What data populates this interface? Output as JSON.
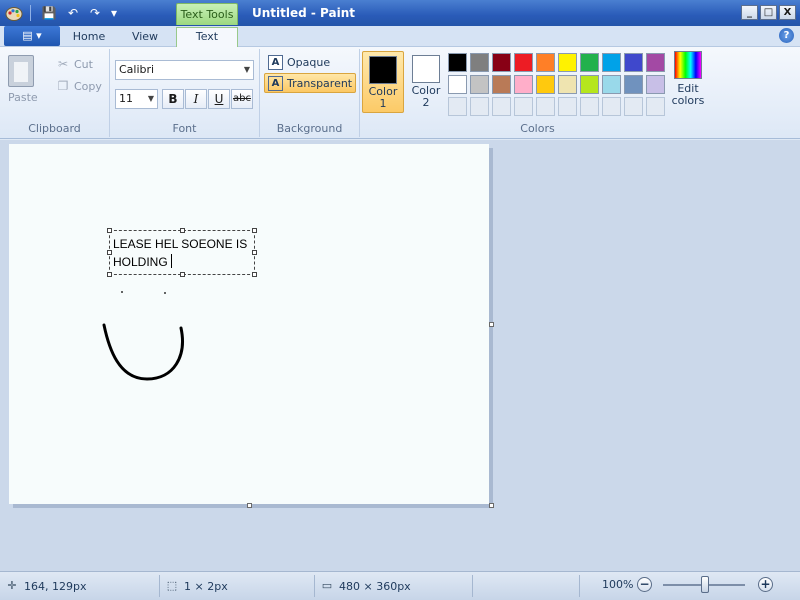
{
  "window": {
    "title": "Untitled - Paint",
    "context_tab_title": "Text Tools",
    "controls": {
      "minimize": "_",
      "maximize": "□",
      "close": "X"
    }
  },
  "quick_access": {
    "save": "💾",
    "undo": "↶",
    "redo": "↷",
    "customize": "▾"
  },
  "ribbon_tabs": {
    "app_menu": "▤ ▾",
    "home": "Home",
    "view": "View",
    "text": "Text",
    "active": "Text",
    "help": "?"
  },
  "clipboard": {
    "paste": "Paste",
    "cut": "Cut",
    "copy": "Copy",
    "label": "Clipboard"
  },
  "font": {
    "family": "Calibri",
    "size": "11",
    "bold": "B",
    "italic": "I",
    "underline": "U",
    "strikethrough": "abc",
    "label": "Font"
  },
  "background": {
    "opaque": "Opaque",
    "transparent": "Transparent",
    "selected": "Transparent",
    "label": "Background"
  },
  "colors": {
    "color1_label": "Color",
    "color1_num": "1",
    "color1_value": "#000000",
    "color2_label": "Color",
    "color2_num": "2",
    "color2_value": "#ffffff",
    "edit_colors_line1": "Edit",
    "edit_colors_line2": "colors",
    "label": "Colors",
    "palette_row1": [
      "#000000",
      "#7f7f7f",
      "#880015",
      "#ed1c24",
      "#ff7f27",
      "#fff200",
      "#22b14c",
      "#00a2e8",
      "#3f48cc",
      "#a349a4"
    ],
    "palette_row2": [
      "#ffffff",
      "#c3c3c3",
      "#b97a57",
      "#ffaec9",
      "#ffc90e",
      "#efe4b0",
      "#b5e61d",
      "#99d9ea",
      "#7092be",
      "#c8bfe7"
    ]
  },
  "canvas": {
    "text_content": "LEASE HEL SOEONE IS HOLDING"
  },
  "status": {
    "cursor_position": "164, 129px",
    "selection_size": "1 × 2px",
    "image_size": "480 × 360px",
    "zoom": "100%",
    "zoom_out": "−",
    "zoom_in": "+"
  }
}
